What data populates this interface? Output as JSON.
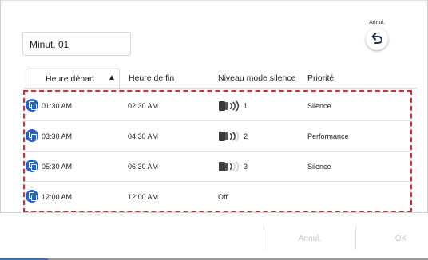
{
  "timer": {
    "title": "Minut. 01"
  },
  "undo": {
    "label": "Annul."
  },
  "table": {
    "headers": {
      "start": "Heure départ",
      "sort_indicator": "▲",
      "end": "Heure de fin",
      "silent_level": "Niveau mode silence",
      "priority": "Priorité"
    },
    "rows": [
      {
        "start": "01:30 AM",
        "end": "02:30 AM",
        "level": "1",
        "priority": "Silence"
      },
      {
        "start": "03:30 AM",
        "end": "04:30 AM",
        "level": "2",
        "priority": "Performance"
      },
      {
        "start": "05:30 AM",
        "end": "06:30 AM",
        "level": "3",
        "priority": "Silence"
      },
      {
        "start": "12:00 AM",
        "end": "12:00 AM",
        "level": "Off",
        "priority": ""
      }
    ]
  },
  "footer": {
    "cancel_label": "Annul.",
    "ok_label": "OK"
  },
  "colors": {
    "accent_blue": "#1e63d6",
    "highlight_red": "#e8262e",
    "disabled_text": "#c8c8c8"
  }
}
